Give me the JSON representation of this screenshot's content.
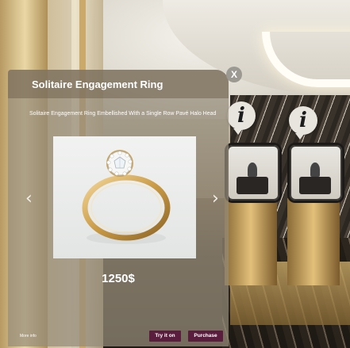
{
  "product": {
    "title": "Solitaire Engagement Ring",
    "description": "Solitaire Engagement Ring Embellished With a Single Row Pavé Halo Head",
    "price": "1250$",
    "image_icon": "gold-ring-with-diamond-halo"
  },
  "controls": {
    "close_label": "X",
    "prev_icon": "‹",
    "next_icon": "›",
    "more_info_label": "More info",
    "try_on_label": "Try it on",
    "purchase_label": "Purchase"
  },
  "hotspots": [
    {
      "glyph": "i"
    },
    {
      "glyph": "i"
    }
  ],
  "colors": {
    "button_bg": "#5a1d3d",
    "panel_bg": "rgba(150,140,122,.72)",
    "gold": "#d4a955"
  }
}
